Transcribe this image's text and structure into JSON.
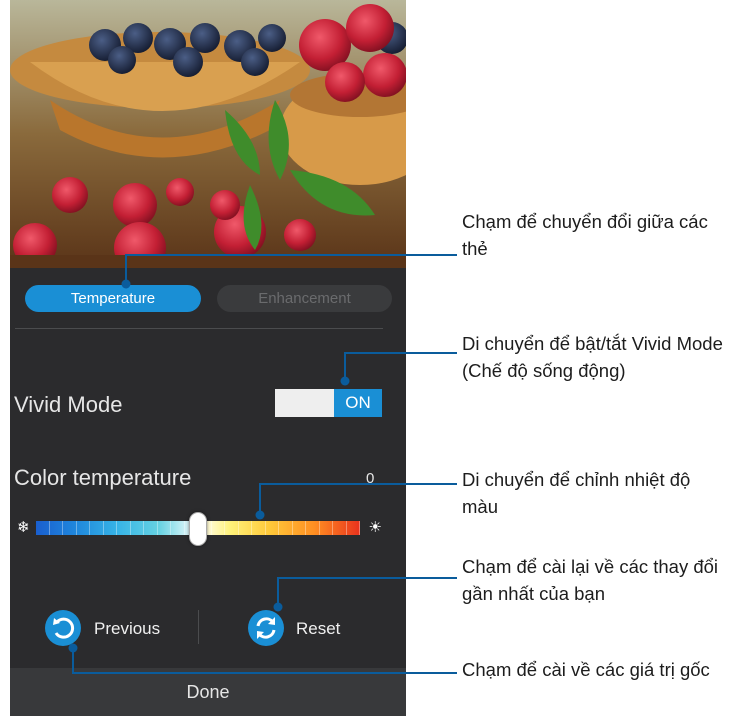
{
  "tabs": {
    "temperature": "Temperature",
    "enhancement": "Enhancement"
  },
  "vivid": {
    "label": "Vivid Mode",
    "toggle_value": "ON"
  },
  "color_temperature": {
    "label": "Color temperature",
    "value": "0",
    "slider_fraction": 0.5
  },
  "actions": {
    "previous": "Previous",
    "reset": "Reset",
    "done": "Done"
  },
  "callouts": {
    "tabs": "Chạm để chuyển đổi giữa các thẻ",
    "vivid": "Di chuyển để bật/tắt Vivid Mode (Chế độ sống động)",
    "slider": "Di chuyển để chỉnh nhiệt độ màu",
    "reset": "Chạm để cài lại về các thay đổi gần nhất của bạn",
    "previous": "Chạm để cài về các giá trị gốc"
  },
  "colors": {
    "accent": "#1a8fd5",
    "panel": "#2b2b2d",
    "callout_line": "#0a5c9c"
  }
}
